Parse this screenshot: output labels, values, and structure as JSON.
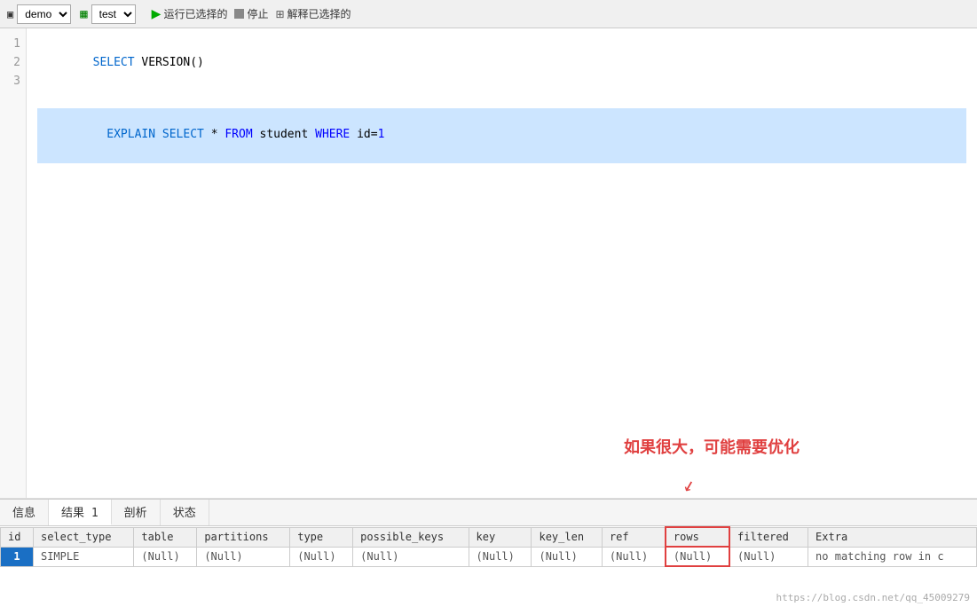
{
  "toolbar": {
    "db_label": "demo",
    "db_options": [
      "demo"
    ],
    "schema_label": "test",
    "schema_options": [
      "test"
    ],
    "run_label": "运行已选择的",
    "stop_label": "停止",
    "explain_label": "解释已选择的"
  },
  "editor": {
    "lines": [
      {
        "num": "1",
        "code": "SELECT VERSION()",
        "highlight": false
      },
      {
        "num": "2",
        "code": "",
        "highlight": false
      },
      {
        "num": "3",
        "code": "EXPLAIN SELECT * FROM student WHERE id=1",
        "highlight": true
      }
    ]
  },
  "tabs": [
    {
      "label": "信息",
      "active": false
    },
    {
      "label": "结果 1",
      "active": true
    },
    {
      "label": "剖析",
      "active": false
    },
    {
      "label": "状态",
      "active": false
    }
  ],
  "table": {
    "headers": [
      "id",
      "select_type",
      "table",
      "partitions",
      "type",
      "possible_keys",
      "key",
      "key_len",
      "ref",
      "rows",
      "filtered",
      "Extra"
    ],
    "rows": [
      [
        "1",
        "SIMPLE",
        "(Null)",
        "(Null)",
        "(Null)",
        "(Null)",
        "(Null)",
        "(Null)",
        "(Null)",
        "(Null)",
        "(Null)",
        "no matching row in c"
      ]
    ]
  },
  "annotation": {
    "text": "如果很大，可能需要优化"
  },
  "watermark": "https://blog.csdn.net/qq_45009279"
}
